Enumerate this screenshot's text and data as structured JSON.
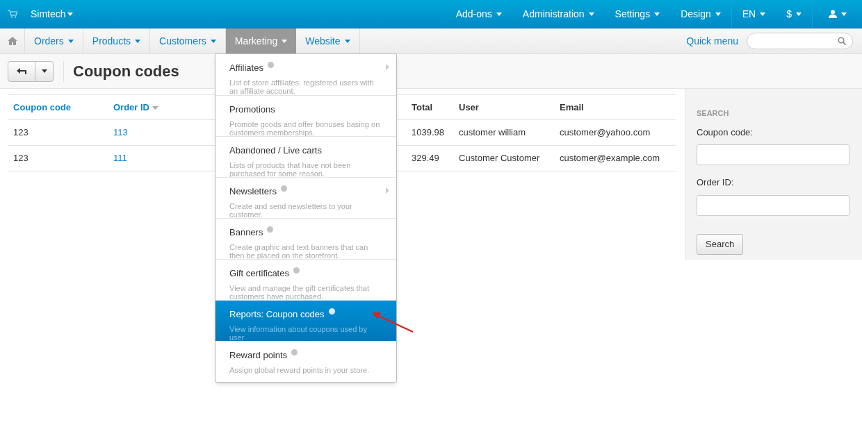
{
  "top_bar": {
    "store": "Simtech",
    "menus": [
      {
        "label": "Add-ons"
      },
      {
        "label": "Administration"
      },
      {
        "label": "Settings"
      },
      {
        "label": "Design"
      }
    ],
    "language": "EN",
    "currency": "$"
  },
  "nav": {
    "tabs": [
      {
        "label": "Orders",
        "selected": false
      },
      {
        "label": "Products",
        "selected": false
      },
      {
        "label": "Customers",
        "selected": false
      },
      {
        "label": "Marketing",
        "selected": true
      },
      {
        "label": "Website",
        "selected": false
      }
    ],
    "quick_menu": "Quick menu"
  },
  "page_title": "Coupon codes",
  "table": {
    "columns": [
      {
        "label": "Coupon code",
        "link": true,
        "sorted": false
      },
      {
        "label": "Order ID",
        "link": true,
        "sorted": true
      },
      {
        "label": "Total",
        "link": false,
        "sorted": false
      },
      {
        "label": "User",
        "link": false,
        "sorted": false
      },
      {
        "label": "Email",
        "link": false,
        "sorted": false
      }
    ],
    "rows": [
      [
        "123",
        "113",
        "1039.98",
        "customer william",
        "customer@yahoo.com"
      ],
      [
        "123",
        "111",
        "329.49",
        "Customer Customer",
        "customer@example.com"
      ]
    ]
  },
  "dropdown": [
    {
      "title": "Affiliates",
      "description": "List of store affiliates, registered users with an affiliate account.",
      "badge": true,
      "submenu": true,
      "selected": false
    },
    {
      "title": "Promotions",
      "description": "Promote goods and offer bonuses basing on customers memberships.",
      "badge": false,
      "submenu": false,
      "selected": false
    },
    {
      "title": "Abandoned / Live carts",
      "description": "Lists of products that have not been purchased for some reason.",
      "badge": false,
      "submenu": false,
      "selected": false
    },
    {
      "title": "Newsletters",
      "description": "Create and send newsletters to your customer.",
      "badge": true,
      "submenu": true,
      "selected": false
    },
    {
      "title": "Banners",
      "description": "Create graphic and text banners that can then be placed on the storefront.",
      "badge": true,
      "submenu": false,
      "selected": false
    },
    {
      "title": "Gift certificates",
      "description": "View and manage the gift certificates that customers have purchased.",
      "badge": true,
      "submenu": false,
      "selected": false
    },
    {
      "title": "Reports: Coupon codes",
      "description": "View information about coupons used by user",
      "badge": true,
      "submenu": false,
      "selected": true
    },
    {
      "title": "Reward points",
      "description": "Assign global reward points in your store.",
      "badge": true,
      "submenu": false,
      "selected": false
    }
  ],
  "search_panel": {
    "heading": "SEARCH",
    "fields": [
      {
        "label": "Coupon code:"
      },
      {
        "label": "Order ID:"
      }
    ],
    "button": "Search"
  }
}
